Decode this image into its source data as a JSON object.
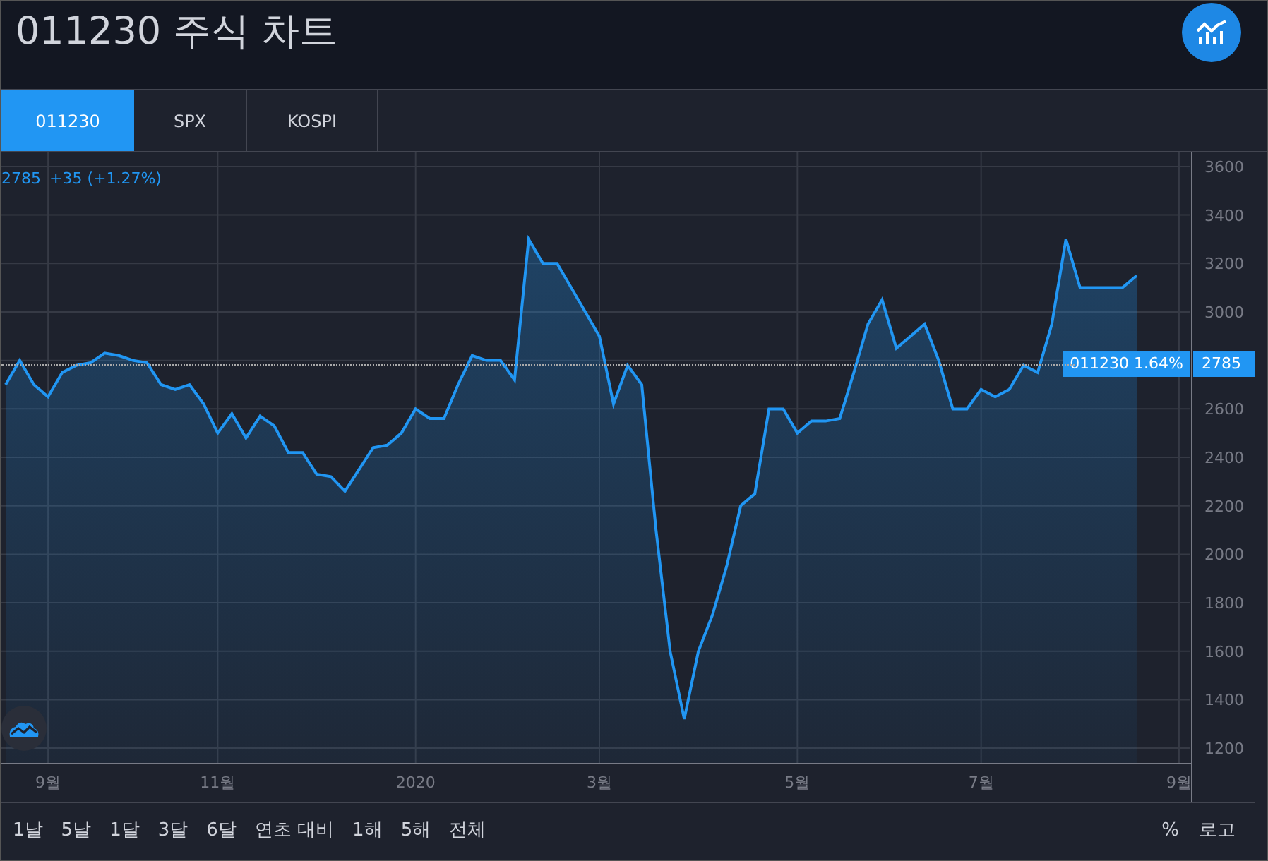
{
  "header": {
    "title": "011230 주식 차트"
  },
  "tabs": [
    {
      "label": "011230",
      "selected": true
    },
    {
      "label": "SPX",
      "selected": false
    },
    {
      "label": "KOSPI",
      "selected": false
    }
  ],
  "legend": {
    "price": "2785",
    "change": "+35 (+1.27%)"
  },
  "price_tag": {
    "change": "1.64%",
    "value": "2785"
  },
  "chart_data": {
    "type": "area",
    "ylim": [
      979,
      3658
    ],
    "grid": true,
    "categories": [
      null,
      null,
      null,
      "9월",
      null,
      null,
      null,
      null,
      null,
      null,
      null,
      null,
      null,
      null,
      null,
      "11월",
      null,
      null,
      null,
      null,
      null,
      null,
      null,
      null,
      null,
      null,
      null,
      null,
      null,
      "2020",
      null,
      null,
      null,
      null,
      null,
      null,
      null,
      null,
      null,
      null,
      null,
      null,
      "3월",
      null,
      null,
      null,
      null,
      null,
      null,
      null,
      null,
      null,
      null,
      null,
      null,
      null,
      "5월",
      null,
      null,
      null,
      null,
      null,
      null,
      null,
      null,
      null,
      null,
      null,
      null,
      "7월",
      null,
      null,
      null,
      null,
      null,
      null,
      null,
      null,
      null,
      null,
      null,
      null,
      null,
      "9월"
    ],
    "yticks": [
      3600,
      3400,
      3200,
      3000,
      2600,
      2400,
      2200,
      2000,
      1800,
      1600,
      1400,
      1200
    ],
    "series": [
      {
        "name": "011230",
        "color": "#2196f3",
        "values": [
          2700,
          2800,
          2700,
          2650,
          2750,
          2780,
          2790,
          2830,
          2820,
          2800,
          2790,
          2700,
          2680,
          2700,
          2620,
          2500,
          2580,
          2480,
          2570,
          2530,
          2420,
          2420,
          2330,
          2320,
          2260,
          2350,
          2440,
          2450,
          2500,
          2600,
          2560,
          2560,
          2700,
          2820,
          2800,
          2800,
          2720,
          3300,
          3200,
          3200,
          3100,
          3000,
          2900,
          2620,
          2780,
          2700,
          2100,
          1600,
          1320,
          1600,
          1750,
          1950,
          2200,
          2250,
          2600,
          2600,
          2500,
          2550,
          2550,
          2560,
          2750,
          2950,
          3050,
          2850,
          2900,
          2950,
          2800,
          2600,
          2600,
          2680,
          2650,
          2680,
          2780,
          2750,
          2950,
          3300,
          3100,
          3100,
          3100,
          3100,
          3150,
          null,
          null,
          null
        ]
      }
    ]
  },
  "ranges": [
    {
      "label": "1날"
    },
    {
      "label": "5날"
    },
    {
      "label": "1달"
    },
    {
      "label": "3달"
    },
    {
      "label": "6달"
    },
    {
      "label": "연초 대비"
    },
    {
      "label": "1해"
    },
    {
      "label": "5해"
    },
    {
      "label": "전체"
    }
  ],
  "scale_options": [
    {
      "label": "%"
    },
    {
      "label": "로고"
    }
  ]
}
